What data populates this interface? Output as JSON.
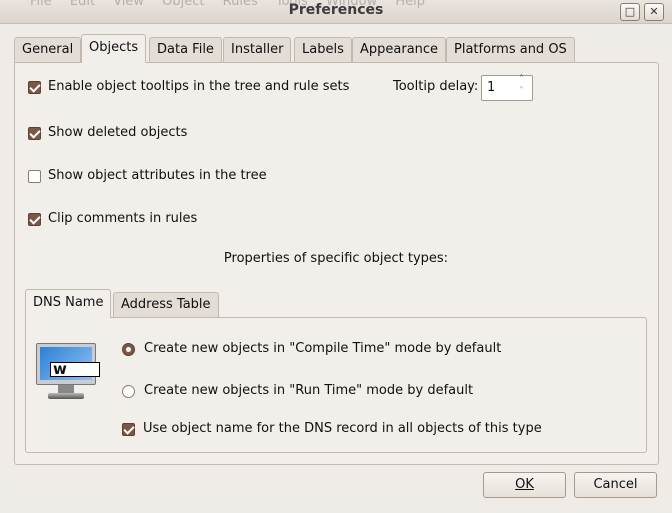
{
  "window": {
    "title": "Preferences",
    "background_menu": "File Edit View Object Rules Tools Window Help"
  },
  "tabs": [
    {
      "label": "General"
    },
    {
      "label": "Objects",
      "active": true
    },
    {
      "label": "Data File"
    },
    {
      "label": "Installer"
    },
    {
      "label": "Labels"
    },
    {
      "label": "Appearance"
    },
    {
      "label": "Platforms and OS"
    }
  ],
  "options": [
    {
      "label": "Enable object tooltips in the tree and rule sets",
      "checked": true
    },
    {
      "label": "Show deleted objects",
      "checked": true
    },
    {
      "label": "Show object attributes in the tree",
      "checked": false
    },
    {
      "label": "Clip comments in rules",
      "checked": true
    }
  ],
  "tooltip_delay": {
    "label": "Tooltip delay:",
    "value": "1"
  },
  "specific_heading": "Properties of specific object types:",
  "subtabs": [
    {
      "label": "DNS Name",
      "active": true
    },
    {
      "label": "Address Table"
    }
  ],
  "dns": {
    "icon": "dns-monitor-icon",
    "icon_text": "w",
    "radio_compile": {
      "label": "Create new objects in \"Compile Time\" mode by default",
      "selected": true
    },
    "radio_run": {
      "label": "Create new objects in \"Run Time\" mode by default",
      "selected": false
    },
    "use_name": {
      "label": "Use object name for the DNS record in all objects of this type",
      "checked": true
    }
  },
  "buttons": {
    "ok": "OK",
    "cancel": "Cancel"
  },
  "colors": {
    "accent": "#7d5745",
    "background": "#efebe7"
  }
}
